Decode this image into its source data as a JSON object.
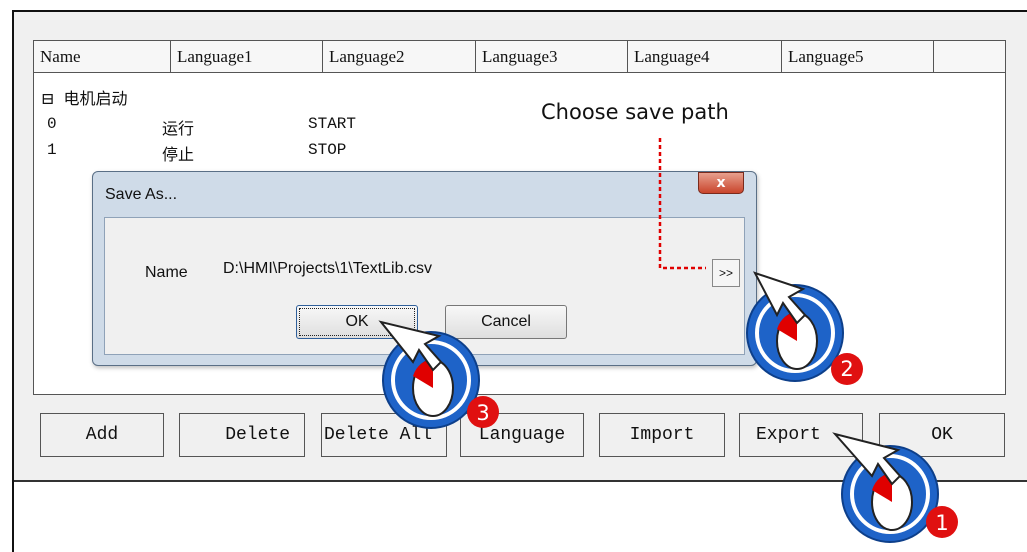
{
  "table": {
    "columns": [
      "Name",
      "Language1",
      "Language2",
      "Language3",
      "Language4",
      "Language5"
    ],
    "group": {
      "toggle": "⊟",
      "name": "电机启动"
    },
    "rows": [
      {
        "index": "0",
        "language1": "运行",
        "language2": "START"
      },
      {
        "index": "1",
        "language1": "停止",
        "language2": "STOP"
      }
    ]
  },
  "toolbar": {
    "add": "Add",
    "delete": "Delete",
    "delete_all": "Delete All",
    "language": "Language",
    "import": "Import",
    "export": "Export",
    "ok": "OK"
  },
  "dialog": {
    "title": "Save As...",
    "close_glyph": "x",
    "name_label": "Name",
    "path_value": "D:\\HMI\\Projects\\1\\TextLib.csv",
    "browse_label": ">>",
    "ok": "OK",
    "cancel": "Cancel"
  },
  "annotation": {
    "text": "Choose save path",
    "steps": [
      "1",
      "2",
      "3"
    ],
    "arrow_color": "#e00000",
    "bubble_color": "#1e63c8",
    "badge_color": "#e01010"
  }
}
